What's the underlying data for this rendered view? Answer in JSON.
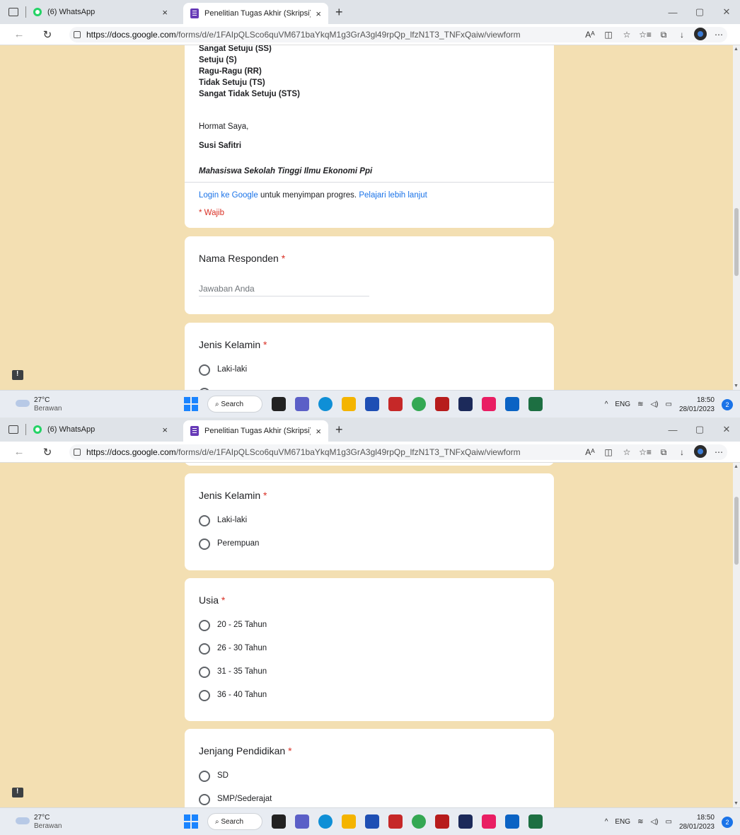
{
  "browser": {
    "tabs": [
      {
        "title": "(6) WhatsApp",
        "close": "×"
      },
      {
        "title": "Penelitian Tugas Akhir (Skripsi) -",
        "close": "×"
      }
    ],
    "new_tab": "+",
    "url_host": "https://docs.google.com",
    "url_path": "/forms/d/e/1FAIpQLSco6quVM671baYkqM1g3GrA3gl49rpQp_lfzN1T3_TNFxQaiw/viewform",
    "window_controls": [
      "—",
      "▢",
      "✕"
    ],
    "toolbar_icons": [
      "Aᴬ",
      "◫",
      "☆",
      "☆≡",
      "⧉",
      "↓",
      "⋯"
    ]
  },
  "form": {
    "scale_options": [
      "Sangat Setuju (SS)",
      "Setuju (S)",
      "Ragu-Ragu (RR)",
      "Tidak Setuju (TS)",
      "Sangat Tidak Setuju (STS)"
    ],
    "closing": "Hormat Saya,",
    "author": "Susi Safitri",
    "author_role": "Mahasiswa Sekolah Tinggi Ilmu Ekonomi Ppi",
    "login_link": "Login ke Google",
    "login_text": "untuk menyimpan progres.",
    "learn_more": "Pelajari lebih lanjut",
    "required_note": "* Wajib",
    "required_mark": "*",
    "q_nama": {
      "title": "Nama Responden",
      "placeholder": "Jawaban Anda"
    },
    "q_gender": {
      "title": "Jenis Kelamin",
      "options": [
        "Laki-laki",
        "Perempuan"
      ]
    },
    "q_usia": {
      "title": "Usia",
      "options": [
        "20 - 25 Tahun",
        "26 - 30 Tahun",
        "31 - 35 Tahun",
        "36 - 40 Tahun"
      ]
    },
    "q_pendidikan": {
      "title": "Jenjang Pendidikan",
      "options": [
        "SD",
        "SMP/Sederajat"
      ]
    }
  },
  "taskbar": {
    "temp": "27°C",
    "weather": "Berawan",
    "search": "Search",
    "lang": "ENG",
    "time": "18:50",
    "date": "28/01/2023",
    "notifications": "2",
    "apps": [
      {
        "name": "file-explorer-icon",
        "color": "#f4b400"
      },
      {
        "name": "store-icon",
        "color": "#1e4fb4"
      },
      {
        "name": "mcafee-icon",
        "color": "#c62828"
      },
      {
        "name": "chrome-icon",
        "color": "#34a853"
      },
      {
        "name": "spss-icon",
        "color": "#b71c1c"
      },
      {
        "name": "slash-app-icon",
        "color": "#1c2a5a"
      },
      {
        "name": "snipping-icon",
        "color": "#e91e63"
      },
      {
        "name": "photos-icon",
        "color": "#0b63c4"
      },
      {
        "name": "excel-icon",
        "color": "#1d6f42"
      }
    ]
  }
}
